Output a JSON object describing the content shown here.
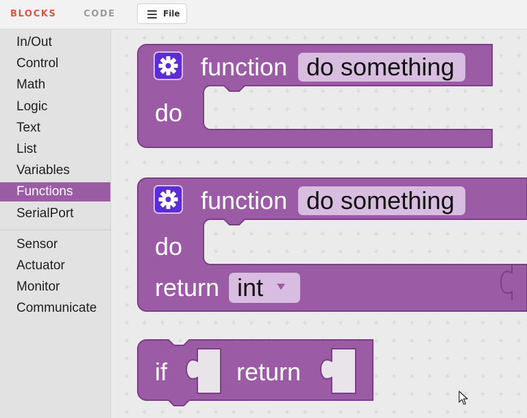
{
  "header": {
    "tabs": [
      {
        "label": "BLOCKS",
        "active": true
      },
      {
        "label": "CODE",
        "active": false
      }
    ],
    "file_button": {
      "label": "File",
      "icon": "menu-icon"
    }
  },
  "sidebar": {
    "categories": [
      {
        "label": "In/Out"
      },
      {
        "label": "Control"
      },
      {
        "label": "Math"
      },
      {
        "label": "Logic"
      },
      {
        "label": "Text"
      },
      {
        "label": "List"
      },
      {
        "label": "Variables"
      },
      {
        "label": "Functions",
        "active": true
      },
      {
        "label": "SerialPort"
      },
      {
        "label": "Sensor"
      },
      {
        "label": "Actuator"
      },
      {
        "label": "Monitor"
      },
      {
        "label": "Communicate"
      }
    ]
  },
  "blocks": {
    "function_block": {
      "keyword": "function",
      "name": "do something",
      "do_label": "do",
      "icon": "gear-icon"
    },
    "function_return_block": {
      "keyword": "function",
      "name": "do something",
      "do_label": "do",
      "return_label": "return",
      "return_type": "int",
      "icon": "gear-icon"
    },
    "if_return_block": {
      "if_label": "if",
      "return_label": "return"
    }
  },
  "colors": {
    "accent": "#e0533f",
    "block": "#9b5ba5",
    "block_dark": "#7b3f85",
    "field": "#d8bde0",
    "active_category": "#9b5ba5",
    "gear_button": "#5c2cd6"
  }
}
